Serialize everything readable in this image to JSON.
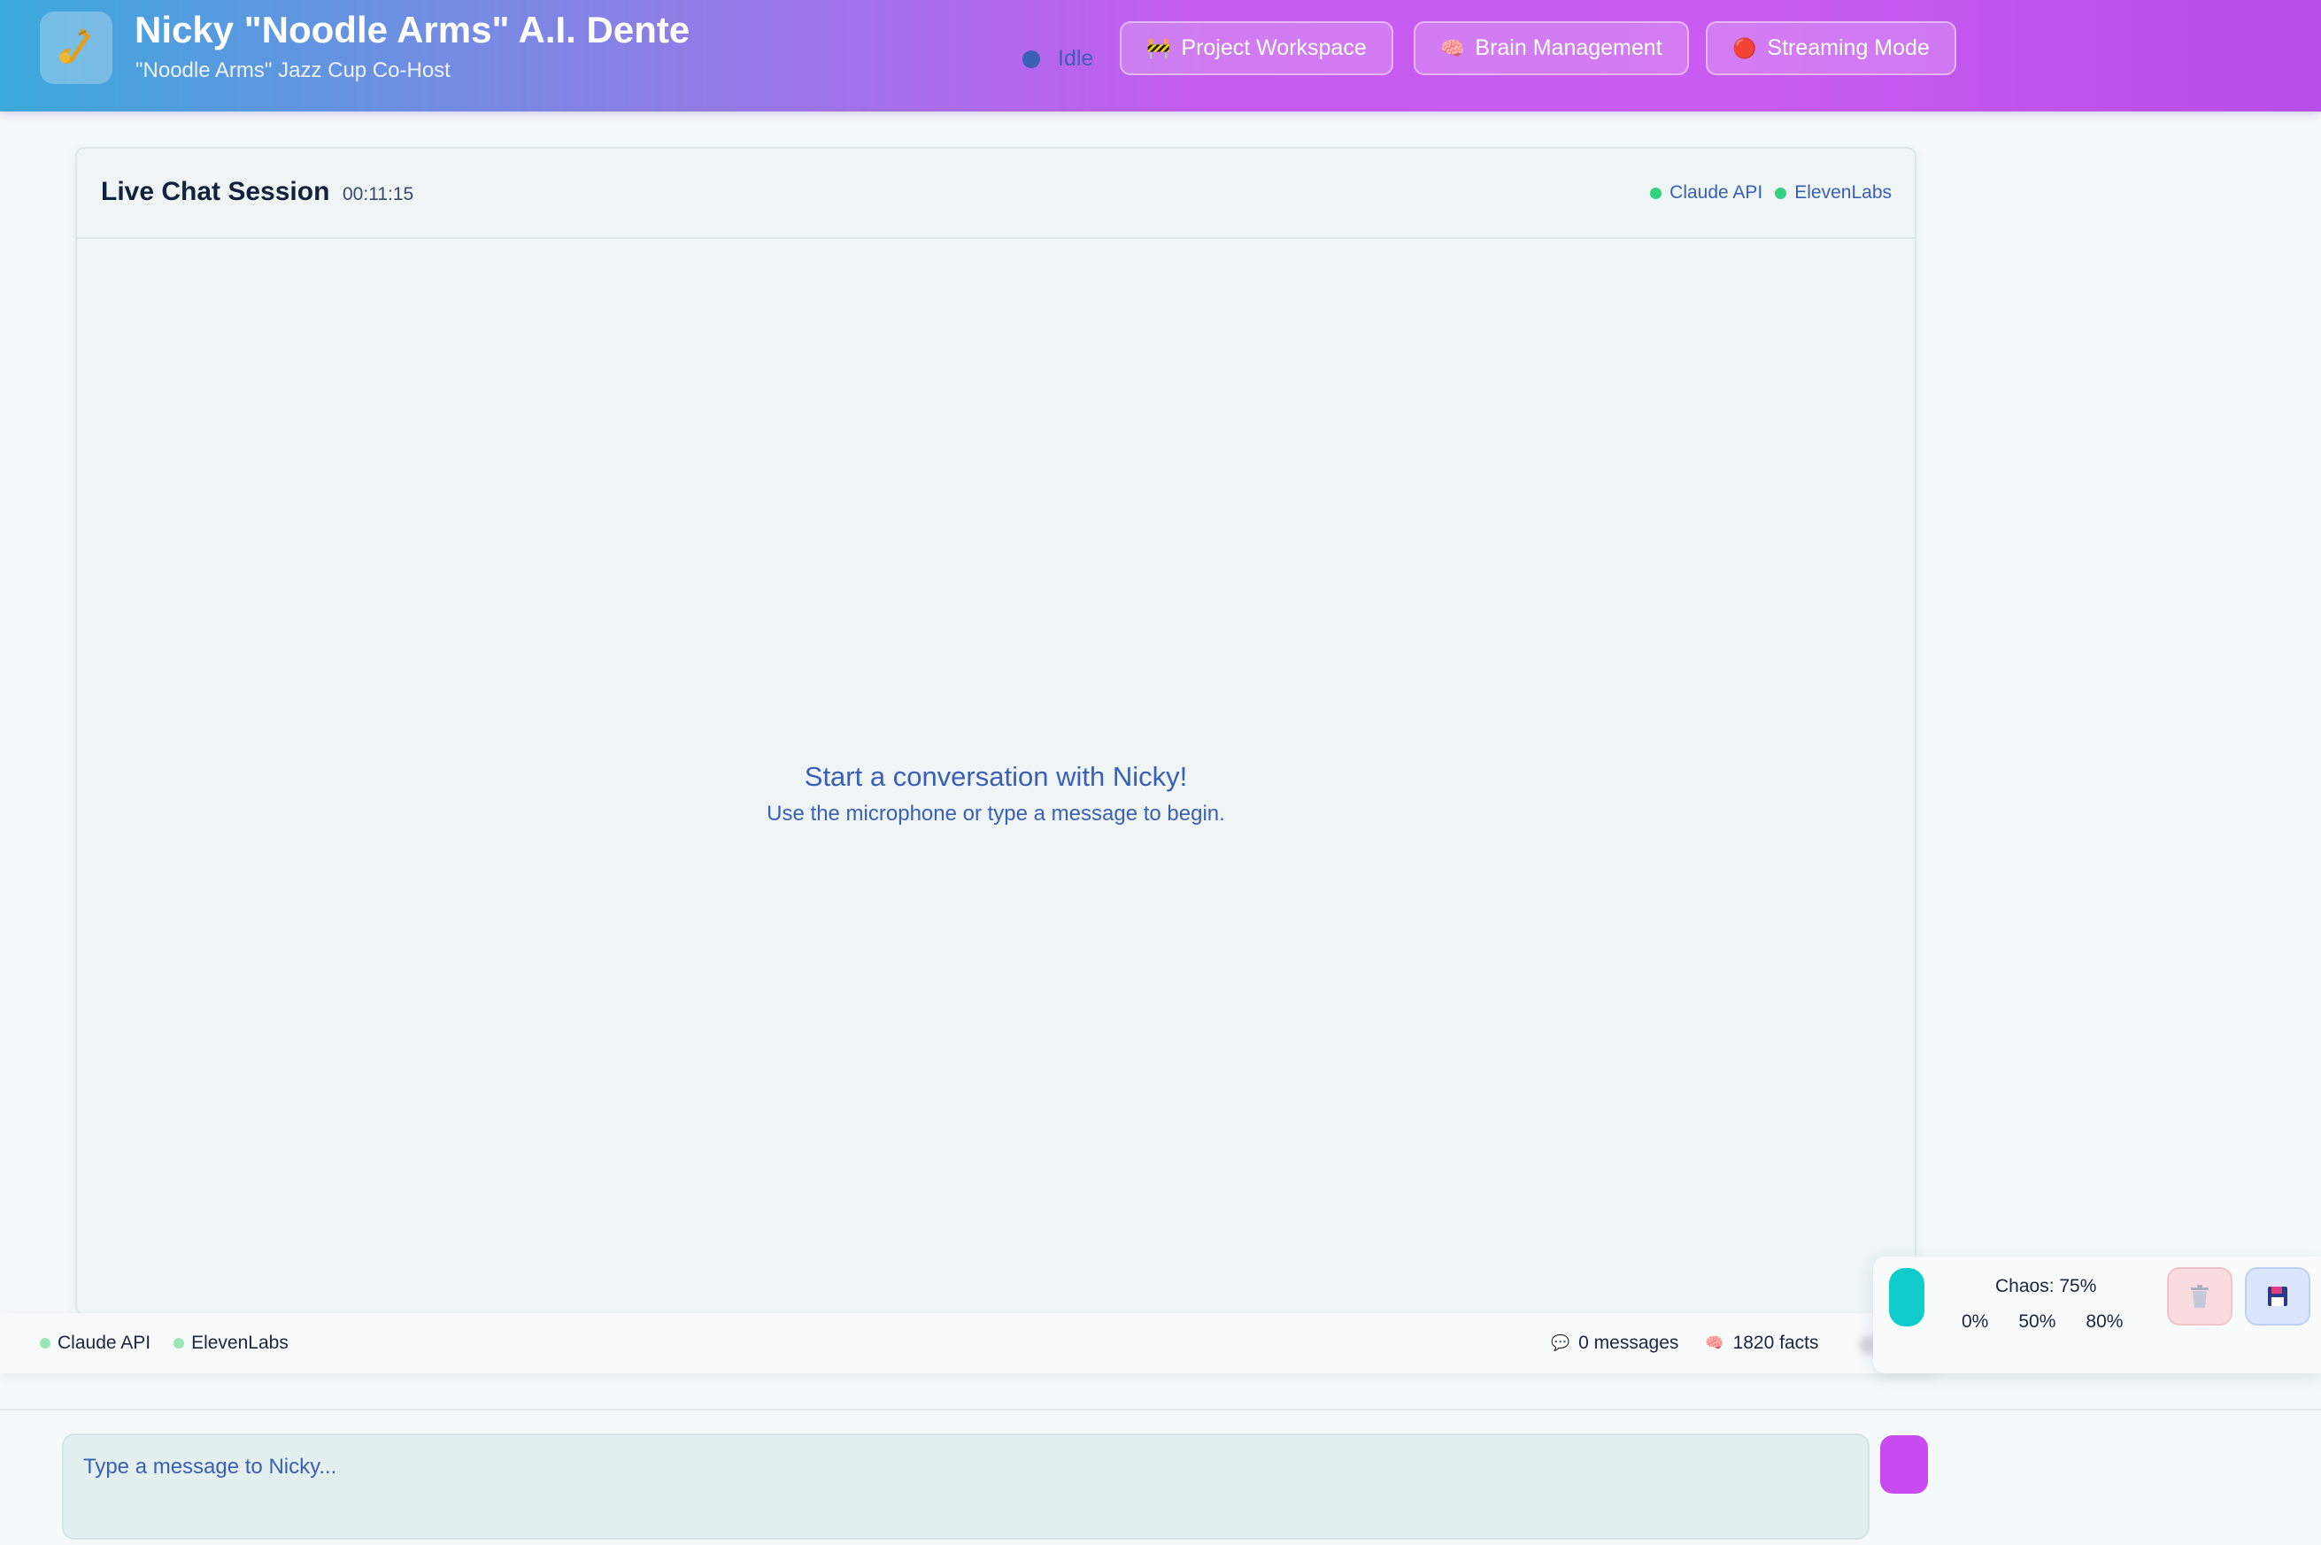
{
  "header": {
    "title": "Nicky \"Noodle Arms\" A.I. Dente",
    "subtitle": "\"Noodle Arms\" Jazz Cup Co-Host",
    "logo_icon": "saxophone-icon",
    "status": "Idle",
    "buttons": [
      {
        "icon": "🚧",
        "icon_name": "construction-icon",
        "label": "Project Workspace"
      },
      {
        "icon": "🧠",
        "icon_name": "brain-icon",
        "label": "Brain Management"
      },
      {
        "icon": "🔴",
        "icon_name": "red-circle-icon",
        "label": "Streaming Mode"
      }
    ]
  },
  "chat": {
    "title": "Live Chat Session",
    "timer": "00:11:15",
    "services": [
      "Claude API",
      "ElevenLabs"
    ],
    "empty_title": "Start a conversation with Nicky!",
    "empty_subtitle": "Use the microphone or type a message to begin."
  },
  "status_bar": {
    "services": [
      "Claude API",
      "ElevenLabs"
    ],
    "messages": "0 messages",
    "facts": "1820 facts"
  },
  "controls": {
    "chaos_label": "Chaos: 75%",
    "presets": [
      "0%",
      "50%",
      "80%"
    ]
  },
  "input": {
    "placeholder": "Type a message to Nicky..."
  },
  "colors": {
    "accent": "#c94bef",
    "toggle": "#11cccc",
    "status_online": "#35d07f"
  }
}
